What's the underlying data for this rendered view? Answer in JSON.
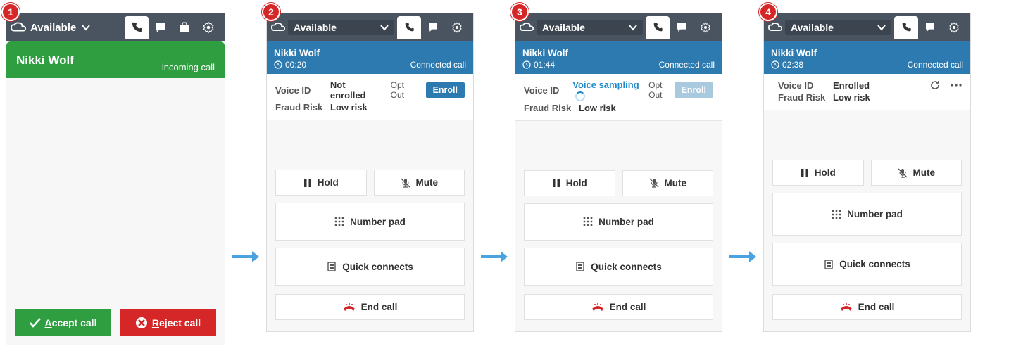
{
  "status_label": "Available",
  "caller_name": "Nikki Wolf",
  "incoming_label": "incoming call",
  "connected_label": "Connected call",
  "voice_id_label": "Voice ID",
  "fraud_label": "Fraud Risk",
  "fraud_value": "Low risk",
  "opt_out": "Opt Out",
  "enroll": "Enroll",
  "hold": "Hold",
  "mute": "Mute",
  "number_pad": "Number pad",
  "quick_connects": "Quick connects",
  "end_call": "End call",
  "accept": "Accept call",
  "reject": "Reject call",
  "panels": [
    {
      "badge": "1"
    },
    {
      "badge": "2",
      "timer": "00:20",
      "voice_id_value": "Not enrolled",
      "enroll_disabled": false
    },
    {
      "badge": "3",
      "timer": "01:44",
      "voice_id_value": "Voice sampling",
      "enroll_disabled": true
    },
    {
      "badge": "4",
      "timer": "02:38",
      "voice_id_value": "Enrolled"
    }
  ]
}
